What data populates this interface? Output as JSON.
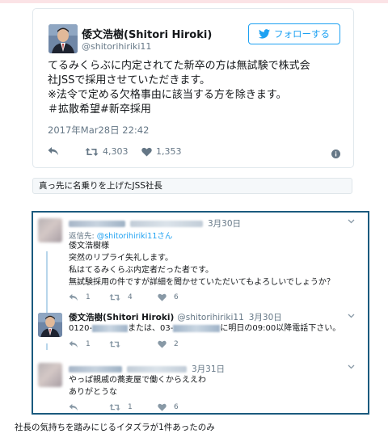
{
  "tweet": {
    "author_name": "倭文浩樹(Shitori Hiroki)",
    "author_handle": "@shitorihiriki11",
    "follow_label": "フォローする",
    "text": "てるみくらぶに内定されてた新卒の方は無試験で株式会\n社JSSで採用させていただきます。\n※法令で定める欠格事由に該当する方を除きます。\n＃拡散希望#新卒採用",
    "date": "2017年Mar28日 22:42",
    "retweets": "4,303",
    "likes": "1,353"
  },
  "caption_top": "真っ先に名乗りを上げたJSS社長",
  "thread": {
    "reply1": {
      "date": "3月30日",
      "reply_prefix": "返信先:",
      "reply_to": "@shitorihiriki11さん",
      "text": "倭文浩樹様\n突然のリプライ失礼します。\n私はてるみくらぶ内定者だった者です。\n無試験採用の件ですが詳細を聞かせていただいてもよろしいでしょうか？",
      "replies": "1",
      "retweets": "4",
      "likes": "6"
    },
    "reply2": {
      "name": "倭文浩樹(Shitori Hiroki)",
      "handle": "@shitorihiriki11",
      "date": "3月30日",
      "text_prefix": "0120-",
      "text_middle": "または、03-",
      "text_suffix": "に明日の09:00以降電話下さい。",
      "replies": "1",
      "likes": "2"
    },
    "reply3": {
      "date": "3月31日",
      "text": "やっぱ親戚の蕎麦屋で働くからええわ\nありがとうな",
      "replies": "1",
      "retweets": "1",
      "likes": "6"
    }
  },
  "caption_bottom": "社長の気持ちを踏みにじるイタズラが1件あったのみ",
  "colors": {
    "twitter_blue": "#1da1f2",
    "thread_border": "#1b5a7e",
    "muted": "#657786"
  },
  "icons": [
    "bird-icon",
    "reply-icon",
    "retweet-icon",
    "heart-icon",
    "info-icon",
    "chevron-down-icon"
  ]
}
